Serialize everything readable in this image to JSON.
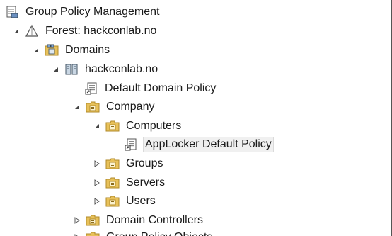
{
  "tree": {
    "root": {
      "label": "Group Policy Management",
      "icon": "gpm-console-icon"
    },
    "forest": {
      "label": "Forest: hackconlab.no",
      "icon": "forest-icon",
      "expanded": true
    },
    "domains": {
      "label": "Domains",
      "icon": "domains-folder-icon",
      "expanded": true
    },
    "domain": {
      "label": "hackconlab.no",
      "icon": "domain-icon",
      "expanded": true
    },
    "default_domain_policy": {
      "label": "Default Domain Policy",
      "icon": "gpo-link-icon"
    },
    "company": {
      "label": "Company",
      "icon": "ou-folder-icon",
      "expanded": true
    },
    "computers": {
      "label": "Computers",
      "icon": "ou-folder-icon",
      "expanded": true
    },
    "applocker_policy": {
      "label": "AppLocker Default Policy",
      "icon": "gpo-link-icon",
      "selected": true
    },
    "groups": {
      "label": "Groups",
      "icon": "ou-folder-icon",
      "expanded": false
    },
    "servers": {
      "label": "Servers",
      "icon": "ou-folder-icon",
      "expanded": false
    },
    "users": {
      "label": "Users",
      "icon": "ou-folder-icon",
      "expanded": false
    },
    "domain_controllers": {
      "label": "Domain Controllers",
      "icon": "ou-folder-icon",
      "expanded": false
    },
    "group_policy_objects": {
      "label": "Group Policy Objects",
      "icon": "folder-icon",
      "expanded": false
    }
  },
  "colors": {
    "folder": "#e8c15a",
    "selection_bg": "#f0f0f0"
  }
}
